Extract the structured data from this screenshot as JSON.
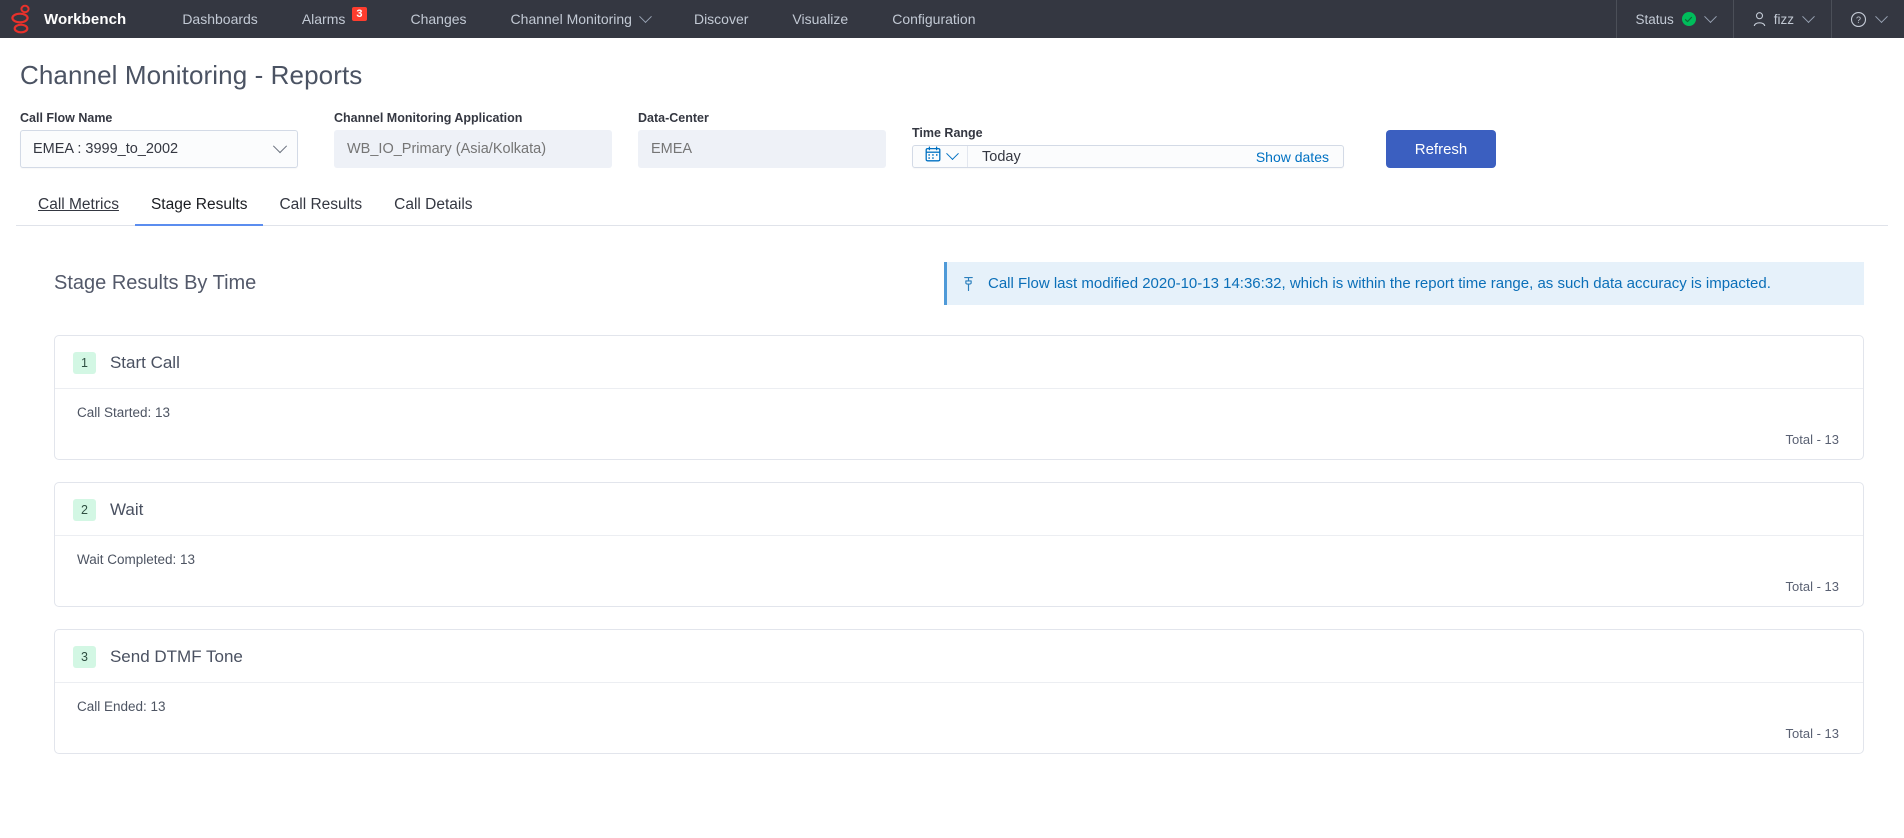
{
  "navbar": {
    "logo_icon": "red-abstract-logo",
    "brand": "Workbench",
    "links": [
      {
        "label": "Dashboards",
        "has_chevron": false,
        "badge": null
      },
      {
        "label": "Alarms",
        "has_chevron": false,
        "badge": "3"
      },
      {
        "label": "Changes",
        "has_chevron": false,
        "badge": null
      },
      {
        "label": "Channel Monitoring",
        "has_chevron": true,
        "badge": null
      },
      {
        "label": "Discover",
        "has_chevron": false,
        "badge": null
      },
      {
        "label": "Visualize",
        "has_chevron": false,
        "badge": null
      },
      {
        "label": "Configuration",
        "has_chevron": false,
        "badge": null
      }
    ],
    "status": {
      "label": "Status",
      "indicator_color": "#00bd5b",
      "icon": "check-circle-icon"
    },
    "user": {
      "label": "fizz",
      "icon": "user-avatar-icon"
    },
    "help": {
      "icon": "help-circle-icon"
    }
  },
  "page": {
    "title": "Channel Monitoring - Reports"
  },
  "filters": {
    "call_flow": {
      "label": "Call Flow Name",
      "value": "EMEA : 3999_to_2002",
      "icon": "chevron-down-icon"
    },
    "application": {
      "label": "Channel Monitoring Application",
      "value": "",
      "placeholder": "WB_IO_Primary (Asia/Kolkata)"
    },
    "data_center": {
      "label": "Data-Center",
      "value": "",
      "placeholder": "EMEA"
    },
    "time_range": {
      "label": "Time Range",
      "value": "Today",
      "calendar_icon": "calendar-icon",
      "chevron_icon": "chevron-down-icon",
      "show_dates_label": "Show dates"
    },
    "refresh_label": "Refresh"
  },
  "tabs": [
    {
      "label": "Call Metrics",
      "active": false,
      "hovered": true
    },
    {
      "label": "Stage Results",
      "active": true,
      "hovered": false
    },
    {
      "label": "Call Results",
      "active": false,
      "hovered": false
    },
    {
      "label": "Call Details",
      "active": false,
      "hovered": false
    }
  ],
  "content": {
    "section_title": "Stage Results By Time",
    "callout": {
      "icon": "pin-icon",
      "text": "Call Flow last modified 2020-10-13 14:36:32, which is within the report time range, as such data accuracy is impacted."
    },
    "stages": [
      {
        "step": "1",
        "title": "Start Call",
        "metric": "Call Started: 13",
        "total": "Total - 13"
      },
      {
        "step": "2",
        "title": "Wait",
        "metric": "Wait Completed: 13",
        "total": "Total - 13"
      },
      {
        "step": "3",
        "title": "Send DTMF Tone",
        "metric": "Call Ended: 13",
        "total": "Total - 13"
      }
    ]
  },
  "colors": {
    "navbar_bg": "#343741",
    "accent_blue": "#3b5fc0",
    "link_blue": "#0071c2",
    "alarm_red": "#ff3d2e",
    "status_green": "#00bd5b",
    "badge_green_bg": "#d3f7e4",
    "callout_bg": "#e6f1fa",
    "callout_border": "#4f9ad8",
    "tab_active_underline": "#5b8def"
  }
}
